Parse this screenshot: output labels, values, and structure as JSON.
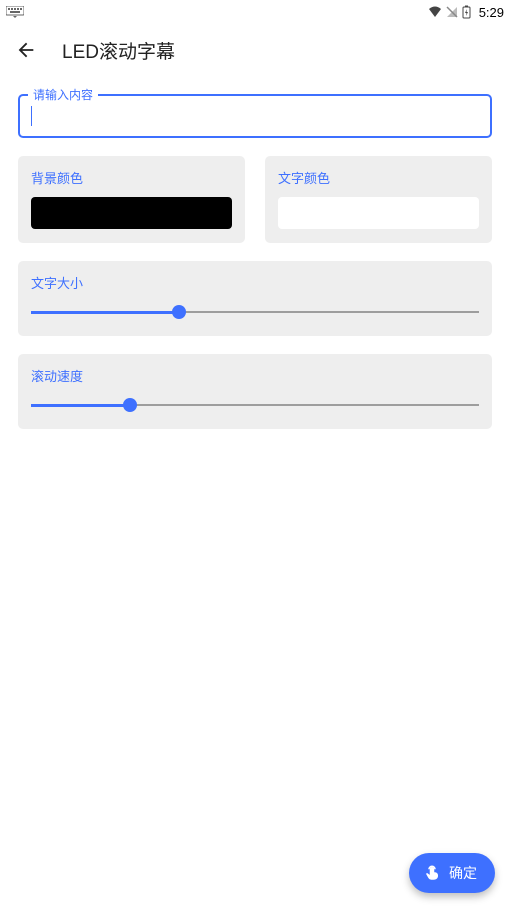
{
  "status": {
    "time": "5:29"
  },
  "header": {
    "title": "LED滚动字幕"
  },
  "input": {
    "label": "请输入内容",
    "value": ""
  },
  "colors": {
    "bg_label": "背景颜色",
    "bg_value": "#000000",
    "fg_label": "文字颜色",
    "fg_value": "#FFFFFF"
  },
  "sliders": {
    "size_label": "文字大小",
    "size_value": 33,
    "speed_label": "滚动速度",
    "speed_value": 22
  },
  "fab": {
    "label": "确定"
  },
  "accent": "#3E70FF"
}
